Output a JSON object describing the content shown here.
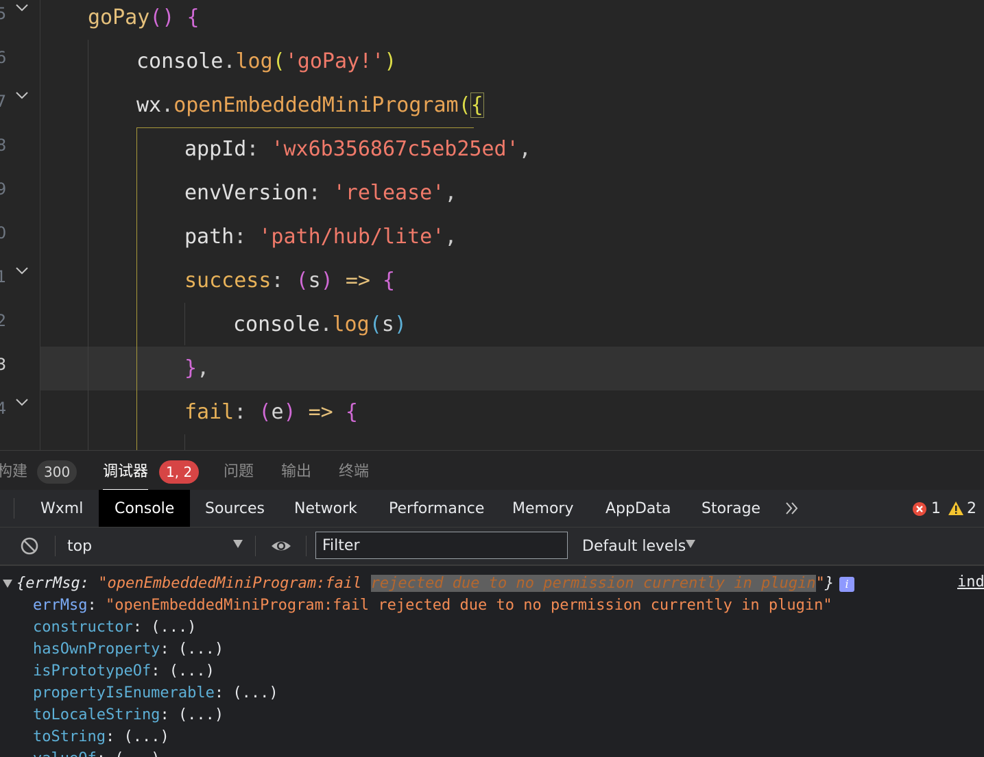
{
  "editor": {
    "line_numbers": [
      "5",
      "6",
      "7",
      "8",
      "9",
      "0",
      "1",
      "2",
      "3",
      "4"
    ],
    "lines": {
      "l1": {
        "fn": "goPay",
        "paren": "()",
        "brace": "{"
      },
      "l2": {
        "obj": "console",
        "dot": ".",
        "fn": "log",
        "po": "(",
        "str": "'goPay!'",
        "pc": ")"
      },
      "l3": {
        "obj": "wx",
        "dot": ".",
        "fn": "openEmbeddedMiniProgram",
        "po": "(",
        "brace": "{"
      },
      "l4": {
        "key": "appId",
        "colon": ":",
        "str": "'wx6b356867c5eb25ed'",
        "comma": ","
      },
      "l5": {
        "key": "envVersion",
        "colon": ":",
        "str": "'release'",
        "comma": ","
      },
      "l6": {
        "key": "path",
        "colon": ":",
        "str": "'path/hub/lite'",
        "comma": ","
      },
      "l7": {
        "key": "success",
        "colon": ":",
        "po": "(",
        "param": "s",
        "pc": ")",
        "arrow": "=>",
        "brace": "{"
      },
      "l8": {
        "obj": "console",
        "dot": ".",
        "fn": "log",
        "po": "(",
        "param": "s",
        "pc": ")"
      },
      "l9": {
        "brace": "}",
        "comma": ","
      },
      "l10": {
        "key": "fail",
        "colon": ":",
        "po": "(",
        "param": "e",
        "pc": ")",
        "arrow": "=>",
        "brace": "{"
      }
    }
  },
  "panel_tabs": {
    "build_label": "构建",
    "build_badge": "300",
    "debugger_label": "调试器",
    "debugger_badge": "1, 2",
    "problems_label": "问题",
    "output_label": "输出",
    "terminal_label": "终端"
  },
  "devtools": {
    "tabs": [
      "Wxml",
      "Console",
      "Sources",
      "Network",
      "Performance",
      "Memory",
      "AppData",
      "Storage"
    ],
    "active_tab": "Console",
    "error_count": "1",
    "warning_count": "2"
  },
  "console_toolbar": {
    "context": "top",
    "filter_placeholder": "Filter",
    "levels": "Default levels"
  },
  "console_output": {
    "summary_open": "{",
    "summary_key": "errMsg",
    "summary_colon": ": ",
    "summary_str_start": "\"openEmbeddedMiniProgram:fail ",
    "summary_str_sel": "rejected due to no permission currently in plugin",
    "summary_str_end": "\"",
    "summary_close": "}",
    "source_link": "ind",
    "err_key": "errMsg",
    "err_value": "\"openEmbeddedMiniProgram:fail rejected due to no permission currently in plugin\"",
    "props": [
      {
        "name": "constructor",
        "value": "(...)"
      },
      {
        "name": "hasOwnProperty",
        "value": "(...)"
      },
      {
        "name": "isPrototypeOf",
        "value": "(...)"
      },
      {
        "name": "propertyIsEnumerable",
        "value": "(...)"
      },
      {
        "name": "toLocaleString",
        "value": "(...)"
      },
      {
        "name": "toString",
        "value": "(...)"
      },
      {
        "name": "valueOf",
        "value": "(...)"
      }
    ]
  },
  "colors": {
    "error_red": "#e74c3c",
    "warning_yellow": "#f4c430",
    "accent_string": "#f07a6a"
  }
}
